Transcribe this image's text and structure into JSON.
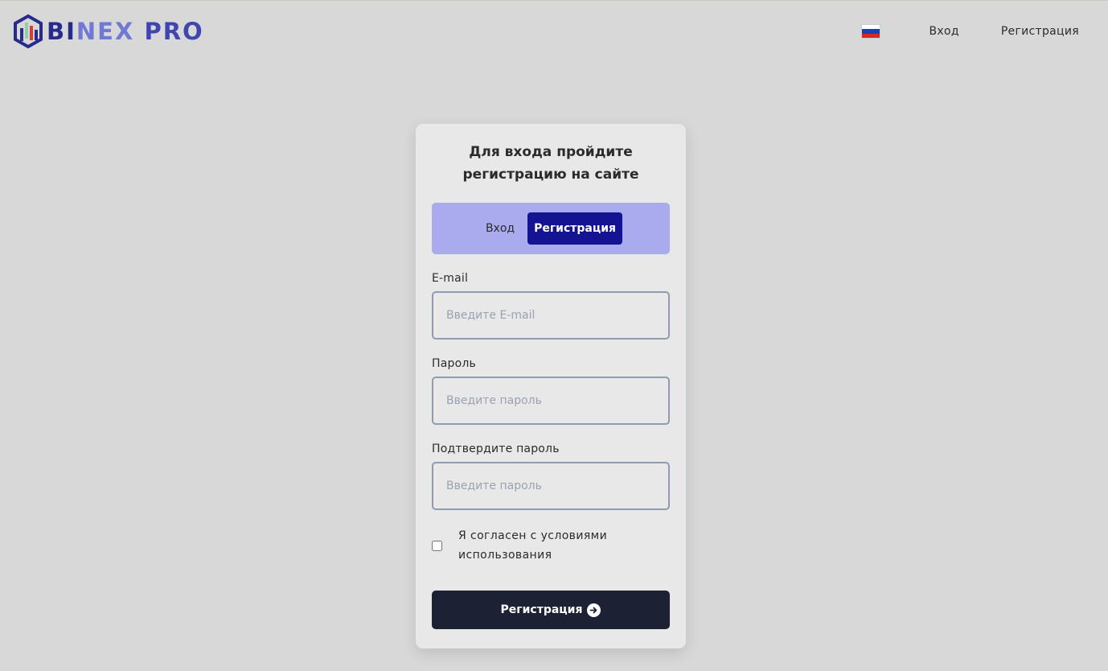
{
  "brand": {
    "part1": "BI",
    "part2": "NEX",
    "part3": " PRO"
  },
  "nav": {
    "flag_icon": "russia-flag-icon",
    "login": "Вход",
    "register": "Регистрация"
  },
  "form": {
    "title": "Для входа пройдите регистрацию на сайте",
    "tabs": [
      {
        "label": "Вход",
        "active": false
      },
      {
        "label": "Регистрация",
        "active": true
      }
    ],
    "email": {
      "label": "E-mail",
      "placeholder": "Введите E-mail",
      "value": ""
    },
    "password": {
      "label": "Пароль",
      "placeholder": "Введите пароль",
      "value": ""
    },
    "confirm": {
      "label": "Подтвердите пароль",
      "placeholder": "Введите пароль",
      "value": ""
    },
    "agree": {
      "label": "Я согласен с условиями использования",
      "checked": false
    },
    "submit": {
      "label": "Регистрация",
      "icon": "arrow-right-circle-icon"
    }
  },
  "colors": {
    "background": "#d8d8d8",
    "card": "#e8e8e8",
    "tabs_bg": "#aaaaee",
    "active_tab": "#141492",
    "submit_bg": "#1c2133",
    "brand_dark": "#262b8c",
    "brand_light": "#7079d4"
  }
}
